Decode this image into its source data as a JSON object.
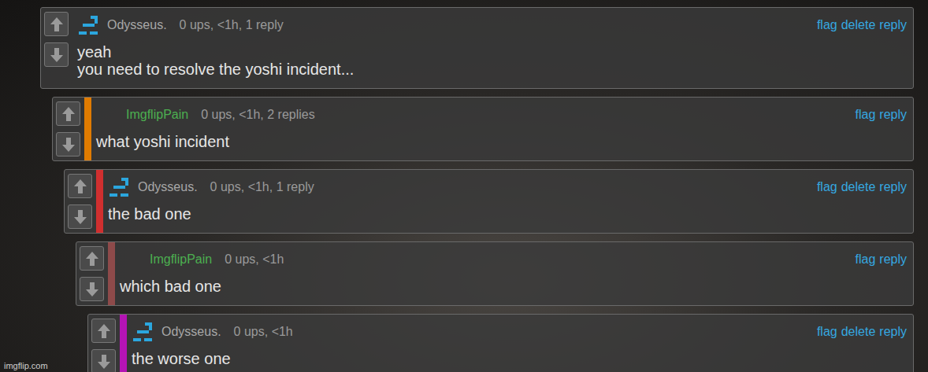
{
  "site": {
    "watermark": "imgflip.com"
  },
  "comments": [
    {
      "user": "Odysseus.",
      "name_color": "#a8a8a8",
      "avatar": true,
      "meta": "0 ups, <1h, 1 reply",
      "color": null,
      "lines": [
        "yeah",
        "you need to resolve the yoshi incident..."
      ],
      "actions": [
        "flag",
        "delete",
        "reply"
      ],
      "replies": [
        {
          "user": "ImgflipPain",
          "name_color": "#4caf50",
          "avatar": false,
          "meta": "0 ups, <1h, 2 replies",
          "color": "#e07b00",
          "lines": [
            "what yoshi incident"
          ],
          "actions": [
            "flag",
            "reply"
          ],
          "replies": [
            {
              "user": "Odysseus.",
              "name_color": "#a8a8a8",
              "avatar": true,
              "meta": "0 ups, <1h, 1 reply",
              "color": "#d02f2f",
              "lines": [
                "the bad one"
              ],
              "actions": [
                "flag",
                "delete",
                "reply"
              ],
              "replies": [
                {
                  "user": "ImgflipPain",
                  "name_color": "#4caf50",
                  "avatar": false,
                  "meta": "0 ups, <1h",
                  "color": "#8e4a4a",
                  "lines": [
                    "which bad one"
                  ],
                  "actions": [
                    "flag",
                    "reply"
                  ],
                  "replies": [
                    {
                      "user": "Odysseus.",
                      "name_color": "#a8a8a8",
                      "avatar": true,
                      "meta": "0 ups, <1h",
                      "color": "#b414b4",
                      "lines": [
                        "the worse one"
                      ],
                      "actions": [
                        "flag",
                        "delete",
                        "reply"
                      ],
                      "replies": []
                    }
                  ]
                }
              ]
            }
          ]
        }
      ]
    }
  ]
}
